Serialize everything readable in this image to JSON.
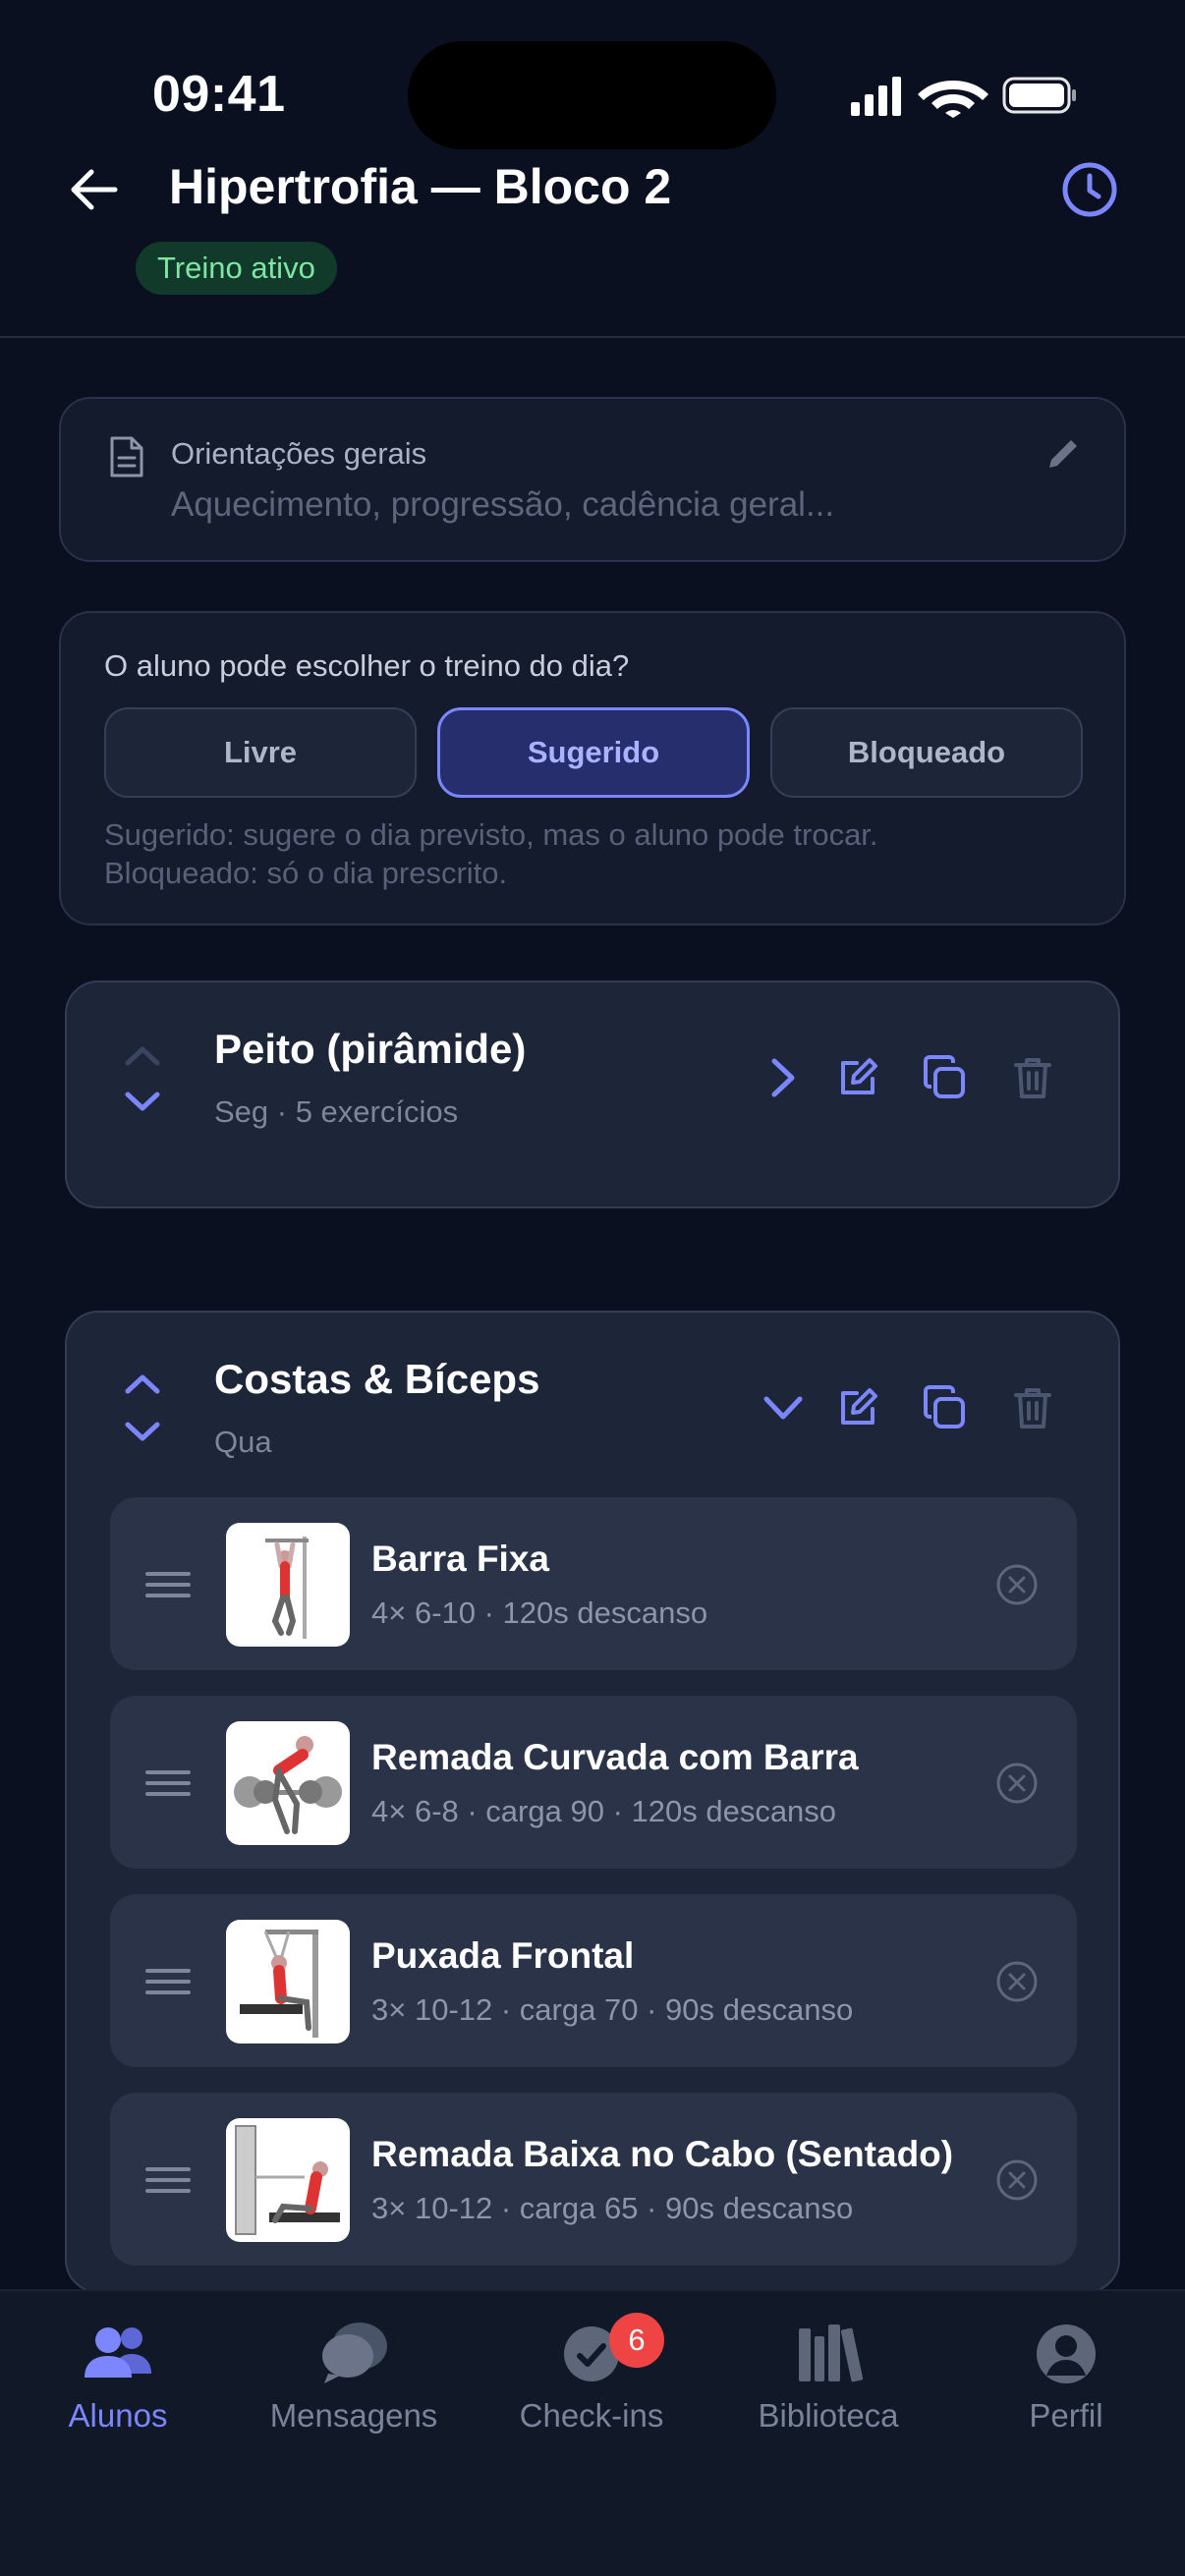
{
  "status_bar": {
    "time": "09:41"
  },
  "header": {
    "title": "Hipertrofia — Bloco 2",
    "badge": "Treino ativo",
    "back_icon": "arrow-left-icon",
    "history_icon": "clock-icon"
  },
  "notes": {
    "label": "Orientações gerais",
    "placeholder": "Aquecimento, progressão, cadência geral..."
  },
  "mode": {
    "question": "O aluno pode escolher o treino do dia?",
    "options": [
      "Livre",
      "Sugerido",
      "Bloqueado"
    ],
    "selected": "Sugerido",
    "help_line1": "Sugerido: sugere o dia previsto, mas o aluno pode trocar.",
    "help_line2": "Bloqueado: só o dia prescrito."
  },
  "days": [
    {
      "title": "Peito (pirâmide)",
      "subtitle": "Seg · 5 exercícios",
      "expanded": false
    },
    {
      "title": "Costas & Bíceps",
      "subtitle": "Qua",
      "expanded": true,
      "exercises": [
        {
          "name": "Barra Fixa",
          "meta": "4× 6-10 · 120s descanso"
        },
        {
          "name": "Remada Curvada com Barra",
          "meta": "4× 6-8 · carga 90 · 120s descanso"
        },
        {
          "name": "Puxada Frontal",
          "meta": "3× 10-12 · carga 70 · 90s descanso"
        },
        {
          "name": "Remada Baixa no Cabo (Sentado)",
          "meta": "3× 10-12 · carga 65 · 90s descanso"
        }
      ]
    }
  ],
  "tabbar": {
    "items": [
      {
        "label": "Alunos",
        "icon": "users-icon",
        "active": true
      },
      {
        "label": "Mensagens",
        "icon": "chat-icon"
      },
      {
        "label": "Check-ins",
        "icon": "check-in-icon",
        "badge": "6"
      },
      {
        "label": "Biblioteca",
        "icon": "library-icon"
      },
      {
        "label": "Perfil",
        "icon": "profile-icon"
      }
    ]
  },
  "colors": {
    "background": "#0b1020",
    "accent": "#7b86ff",
    "active_badge_bg": "#113a2a",
    "active_badge_text": "#7ee6a4",
    "notification": "#ef4444"
  }
}
